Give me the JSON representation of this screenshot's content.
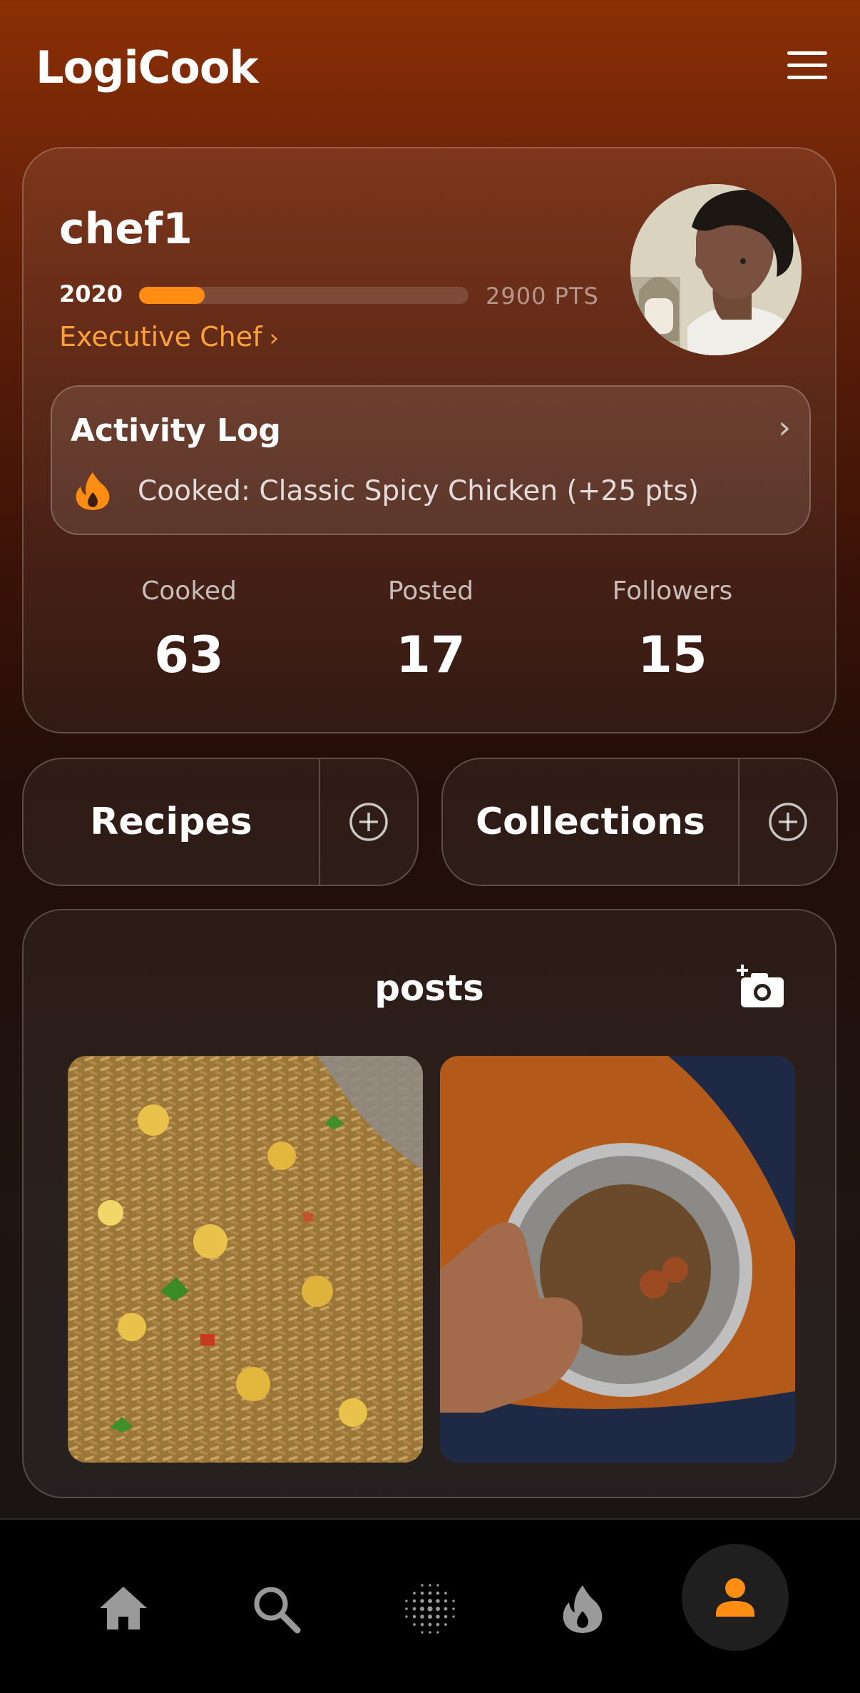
{
  "header": {
    "app_title": "LogiCook",
    "menu_icon": "hamburger-menu-icon"
  },
  "profile": {
    "username": "chef1",
    "year": "2020",
    "points_label": "2900 PTS",
    "progress_fraction": 0.2,
    "rank": "Executive Chef",
    "rank_chevron": "›",
    "accent_color": "#ff8d14"
  },
  "activity": {
    "title": "Activity Log",
    "chevron": "›",
    "entry_icon": "fire-icon",
    "entry_text": "Cooked: Classic Spicy Chicken (+25 pts)"
  },
  "stats": [
    {
      "label": "Cooked",
      "value": "63"
    },
    {
      "label": "Posted",
      "value": "17"
    },
    {
      "label": "Followers",
      "value": "15"
    }
  ],
  "sections": {
    "recipes_label": "Recipes",
    "collections_label": "Collections"
  },
  "posts": {
    "title": "posts",
    "add_icon": "add-photo-camera-icon",
    "items": [
      {
        "image": "fried-rice-photo"
      },
      {
        "image": "noodles-bowl-thumbs-up-photo"
      }
    ]
  },
  "bottom_nav": {
    "items": [
      "home-icon",
      "search-icon",
      "dots-grid-icon",
      "flame-icon",
      "profile-icon"
    ],
    "active": "profile-icon"
  }
}
